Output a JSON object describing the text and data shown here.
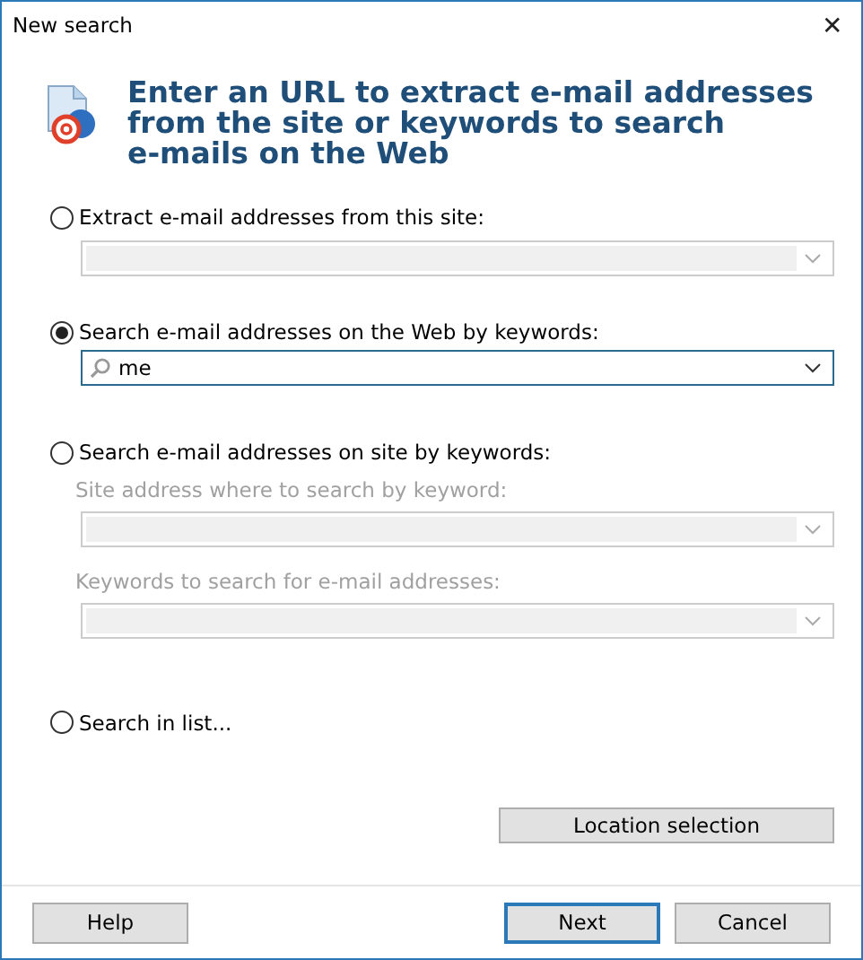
{
  "window": {
    "title": "New search",
    "close": "✕"
  },
  "heading_lines": [
    "Enter an URL to extract e-mail addresses",
    "from the site or keywords to search",
    "e-mails on the Web"
  ],
  "options": [
    {
      "label": "Extract e-mail addresses from this site:",
      "selected": false,
      "fields": [
        {
          "disabled": true
        }
      ]
    },
    {
      "label": "Search e-mail addresses on the Web by keywords:",
      "selected": true,
      "fields": [
        {
          "disabled": false,
          "value": "me",
          "search_icon": true
        }
      ]
    },
    {
      "label": "Search e-mail addresses on site by keywords:",
      "selected": false,
      "fields": [
        {
          "label": "Site address where to search by keyword:",
          "disabled": true
        },
        {
          "label": "Keywords to search for e-mail addresses:",
          "disabled": true
        }
      ]
    },
    {
      "label": "Search in list...",
      "selected": false
    }
  ],
  "location_button": "Location selection",
  "footer_buttons": [
    {
      "label": "Help",
      "default": false
    },
    {
      "label": "Next",
      "default": true
    },
    {
      "label": "Cancel",
      "default": false
    }
  ]
}
